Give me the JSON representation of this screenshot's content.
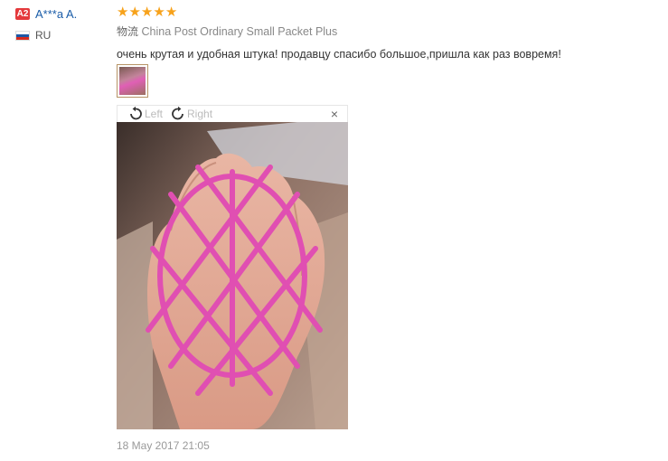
{
  "reviewer": {
    "level_badge": "A2",
    "name": "A***a A.",
    "country_code": "RU",
    "flag_colors": [
      "#ffffff",
      "#1c57a5",
      "#d52b1e"
    ]
  },
  "review": {
    "rating_stars": 5,
    "star_glyph": "★",
    "shipping_label": "物流",
    "shipping_method": "China Post Ordinary Small Packet Plus",
    "comment": "очень крутая и удобная штука! продавцу спасибо большое,пришла как раз вовремя!",
    "date": "18 May 2017 21:05"
  },
  "viewer": {
    "rotate_left_label": "Left",
    "rotate_right_label": "Right",
    "close_glyph": "×",
    "rotate_left_icon": "rotate-left-icon",
    "rotate_right_icon": "rotate-right-icon"
  },
  "colors": {
    "accent_badge": "#e4393c",
    "name_link": "#1a5ca8",
    "star": "#f7a21b",
    "product_pink": "#e04fb2"
  }
}
